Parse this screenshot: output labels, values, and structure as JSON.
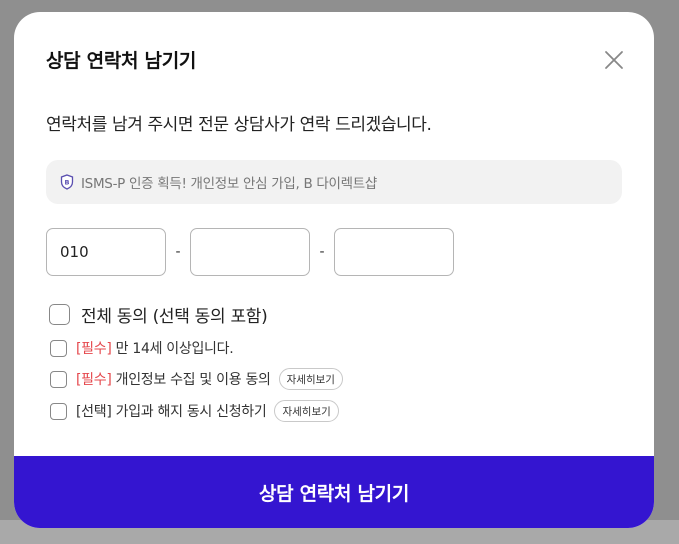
{
  "modal": {
    "title": "상담 연락처 남기기",
    "subtitle": "연락처를 남겨 주시면 전문 상담사가 연락 드리겠습니다.",
    "notice": "ISMS-P 인증 획득! 개인정보 안심 가입, B 다이렉트샵"
  },
  "phone": {
    "part1": "010",
    "part2": "",
    "part3": "",
    "separator": "-"
  },
  "consent": {
    "all": "전체 동의 (선택 동의 포함)",
    "items": [
      {
        "tag": "[필수]",
        "text": " 만 14세 이상입니다.",
        "detail": ""
      },
      {
        "tag": "[필수]",
        "text": " 개인정보 수집 및 이용 동의",
        "detail": "자세히보기"
      },
      {
        "tag": "",
        "text": "[선택] 가입과 해지 동시 신청하기",
        "detail": "자세히보기"
      }
    ]
  },
  "submit_label": "상담 연락처 남기기",
  "colors": {
    "primary": "#3415d0",
    "required": "#e5484d",
    "backdrop": "#8f8f8f"
  },
  "icons": {
    "close": "close-icon",
    "notice": "shield-icon"
  }
}
